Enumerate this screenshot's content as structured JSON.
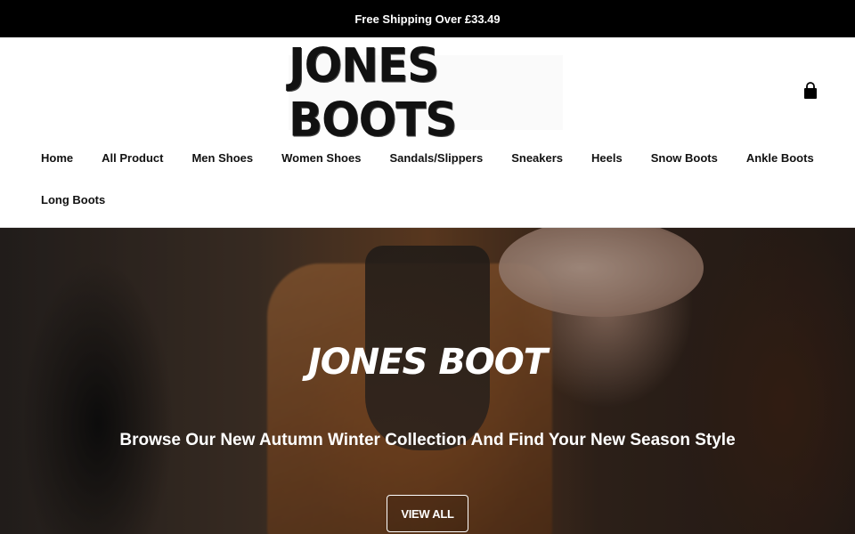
{
  "announcement": {
    "text": "Free Shipping Over £33.49"
  },
  "header": {
    "logo_text": "JONES BOOTS",
    "cart_icon": "shopping-bag-icon"
  },
  "nav": {
    "row1": [
      "Home",
      "All Product",
      "Men Shoes",
      "Women Shoes",
      "Sandals/Slippers",
      "Sneakers",
      "Heels",
      "Snow Boots",
      "Ankle Boots"
    ],
    "row2": [
      "Long Boots"
    ]
  },
  "hero": {
    "title": "JONES BOOT",
    "subtitle": "Browse Our New Autumn Winter Collection And Find Your New Season Style",
    "button_label": "VIEW ALL"
  },
  "colors": {
    "announcement_bg": "#000000",
    "text": "#111111",
    "hero_text": "#ffffff"
  }
}
